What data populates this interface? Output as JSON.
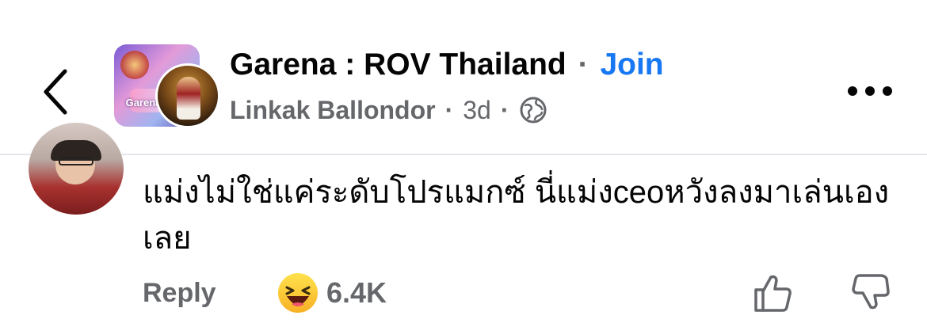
{
  "header": {
    "group_name": "Garena : ROV Thailand",
    "separator": "·",
    "join_label": "Join",
    "author": "Linkak Ballondor",
    "time": "3d",
    "privacy_icon": "globe-icon",
    "group_avatar_text": "Garena"
  },
  "comment": {
    "text": "แม่งไม่ใช่แค่ระดับโปรแมกซ์ นี่แม่งceoหวังลงมาเล่นเองเลย",
    "reply_label": "Reply",
    "reaction_icon": "haha-emoji-icon",
    "reaction_count": "6.4K"
  },
  "colors": {
    "accent": "#1877f2",
    "secondary_text": "#65676b",
    "divider": "#e4e6eb"
  }
}
